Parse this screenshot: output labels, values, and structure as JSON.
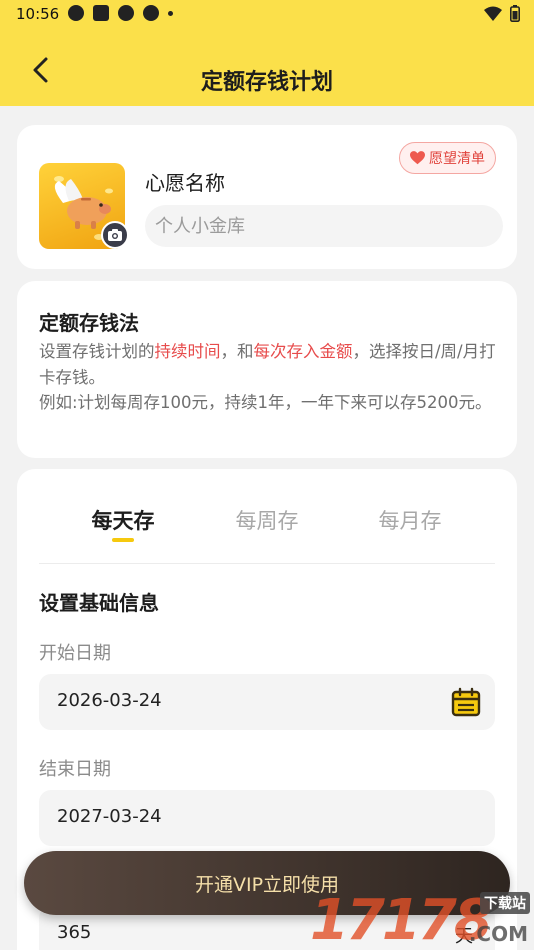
{
  "status_bar": {
    "time": "10:56"
  },
  "header": {
    "title": "定额存钱计划"
  },
  "wish": {
    "label": "心愿名称",
    "placeholder": "个人小金库",
    "wishlist_button": "愿望清单"
  },
  "method": {
    "title": "定额存钱法",
    "desc_part1": "设置存钱计划的",
    "desc_highlight1": "持续时间",
    "desc_part2": "，和",
    "desc_highlight2": "每次存入金额",
    "desc_part3": "，选择按日/周/月打卡存钱。",
    "example": "例如:计划每周存100元，持续1年，一年下来可以存5200元。"
  },
  "tabs": [
    {
      "label": "每天存",
      "active": true
    },
    {
      "label": "每周存",
      "active": false
    },
    {
      "label": "每月存",
      "active": false
    }
  ],
  "form": {
    "section_title": "设置基础信息",
    "start_date_label": "开始日期",
    "start_date": "2026-03-24",
    "end_date_label": "结束日期",
    "end_date": "2027-03-24",
    "days_value": "365",
    "days_unit": "天"
  },
  "vip_button": "开通VIP立即使用",
  "watermark": {
    "digits": "17178",
    "tag": "下载站",
    "suffix": ".COM"
  },
  "colors": {
    "header_bg": "#fbe04a",
    "accent": "#f6c90e",
    "highlight": "#e74c4c"
  }
}
